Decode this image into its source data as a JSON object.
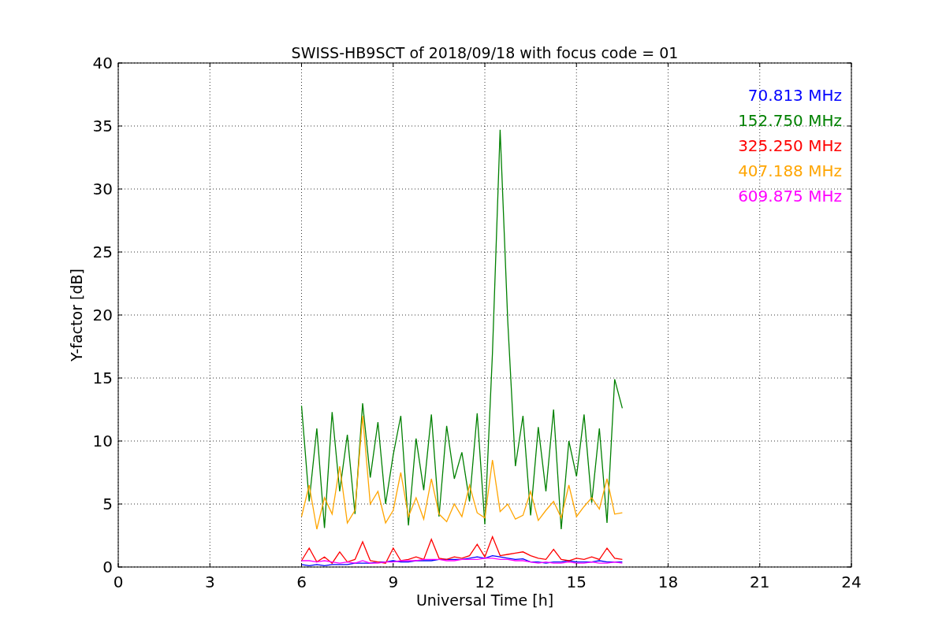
{
  "chart_data": {
    "type": "line",
    "title": "SWISS-HB9SCT of 2018/09/18 with focus code = 01",
    "xlabel": "Universal Time [h]",
    "ylabel": "Y-factor [dB]",
    "grid": true,
    "xlim": [
      0,
      24
    ],
    "ylim": [
      0,
      40
    ],
    "xticks": [
      0,
      3,
      6,
      9,
      12,
      15,
      18,
      21,
      24
    ],
    "yticks": [
      0,
      5,
      10,
      15,
      20,
      25,
      30,
      35,
      40
    ],
    "x": [
      6,
      6.25,
      6.5,
      6.75,
      7,
      7.25,
      7.5,
      7.75,
      8,
      8.25,
      8.5,
      8.75,
      9,
      9.25,
      9.5,
      9.75,
      10,
      10.25,
      10.5,
      10.75,
      11,
      11.25,
      11.5,
      11.75,
      12,
      12.25,
      12.5,
      12.75,
      13,
      13.25,
      13.5,
      13.75,
      14,
      14.25,
      14.5,
      14.75,
      15,
      15.25,
      15.5,
      15.75,
      16,
      16.25,
      16.5
    ],
    "series": [
      {
        "name": "70.813 MHz",
        "color": "#0000ff",
        "values": [
          0.2,
          0.1,
          0.2,
          0.1,
          0.2,
          0.2,
          0.2,
          0.3,
          0.3,
          0.3,
          0.4,
          0.4,
          0.5,
          0.4,
          0.4,
          0.5,
          0.5,
          0.5,
          0.6,
          0.6,
          0.6,
          0.6,
          0.7,
          0.8,
          0.7,
          0.9,
          0.8,
          0.7,
          0.6,
          0.65,
          0.4,
          0.4,
          0.3,
          0.4,
          0.4,
          0.5,
          0.4,
          0.4,
          0.4,
          0.5,
          0.4,
          0.4,
          0.4
        ]
      },
      {
        "name": "152.750 MHz",
        "color": "#008000",
        "values": [
          12.8,
          5.2,
          11.0,
          3.1,
          12.3,
          6.0,
          10.5,
          4.2,
          13.0,
          7.1,
          11.5,
          5.0,
          8.9,
          12.0,
          3.3,
          10.2,
          6.1,
          12.1,
          4.0,
          11.2,
          7.0,
          9.1,
          5.2,
          12.2,
          3.4,
          17.0,
          34.7,
          19.5,
          8.0,
          12.0,
          4.1,
          11.1,
          6.0,
          12.5,
          3.0,
          10.0,
          7.2,
          12.1,
          5.1,
          11.0,
          3.5,
          14.9,
          12.6
        ]
      },
      {
        "name": "325.250 MHz",
        "color": "#ff0000",
        "values": [
          0.5,
          1.5,
          0.4,
          0.8,
          0.3,
          1.2,
          0.4,
          0.6,
          2.0,
          0.5,
          0.4,
          0.3,
          1.5,
          0.5,
          0.6,
          0.8,
          0.6,
          2.2,
          0.7,
          0.6,
          0.8,
          0.7,
          0.9,
          1.8,
          0.8,
          2.4,
          0.9,
          1.0,
          1.1,
          1.2,
          0.9,
          0.7,
          0.6,
          1.4,
          0.6,
          0.5,
          0.7,
          0.6,
          0.8,
          0.6,
          1.5,
          0.7,
          0.6
        ]
      },
      {
        "name": "407.188 MHz",
        "color": "#ffa500",
        "values": [
          4.0,
          6.5,
          3.0,
          5.5,
          4.2,
          8.0,
          3.5,
          4.5,
          12.0,
          5.0,
          6.0,
          3.5,
          4.5,
          7.5,
          4.0,
          5.5,
          3.8,
          7.0,
          4.2,
          3.6,
          5.0,
          4.0,
          6.5,
          4.3,
          3.9,
          8.5,
          4.4,
          5.0,
          3.8,
          4.1,
          6.0,
          3.7,
          4.5,
          5.2,
          3.9,
          6.5,
          4.0,
          4.8,
          5.5,
          4.6,
          7.0,
          4.2,
          4.3
        ]
      },
      {
        "name": "609.875 MHz",
        "color": "#ff00ff",
        "values": [
          0.5,
          0.5,
          0.4,
          0.5,
          0.4,
          0.3,
          0.4,
          0.3,
          0.5,
          0.3,
          0.3,
          0.4,
          0.4,
          0.5,
          0.5,
          0.5,
          0.6,
          0.6,
          0.6,
          0.5,
          0.5,
          0.6,
          0.6,
          0.6,
          0.7,
          0.7,
          0.6,
          0.6,
          0.5,
          0.5,
          0.4,
          0.3,
          0.4,
          0.3,
          0.3,
          0.4,
          0.3,
          0.3,
          0.4,
          0.3,
          0.3,
          0.4,
          0.3
        ]
      }
    ]
  }
}
